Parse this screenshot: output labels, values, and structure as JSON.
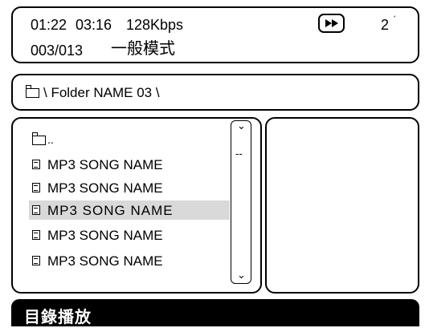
{
  "status": {
    "elapsed": "01:22",
    "total": "03:16",
    "bitrate": "128Kbps",
    "track": "003/013",
    "mode": "一般模式",
    "repeat_num": "2",
    "ff_icon": "fast-forward-icon"
  },
  "path": {
    "folder_icon": "folder-icon",
    "text": "\\ Folder NAME 03 \\"
  },
  "list": {
    "parent": "..",
    "items": [
      {
        "label": "MP3 SONG NAME",
        "selected": false
      },
      {
        "label": "MP3 SONG NAME",
        "selected": false
      },
      {
        "label": "MP3 SONG NAME",
        "selected": true
      },
      {
        "label": "MP3 SONG NAME",
        "selected": false
      },
      {
        "label": "MP3 SONG NAME",
        "selected": false
      }
    ],
    "scroll_marker": "--"
  },
  "footer": {
    "title": "目錄播放"
  },
  "colors": {
    "selection": "#d9d9d9",
    "footer_bg": "#000000",
    "footer_text": "#ffffff"
  }
}
